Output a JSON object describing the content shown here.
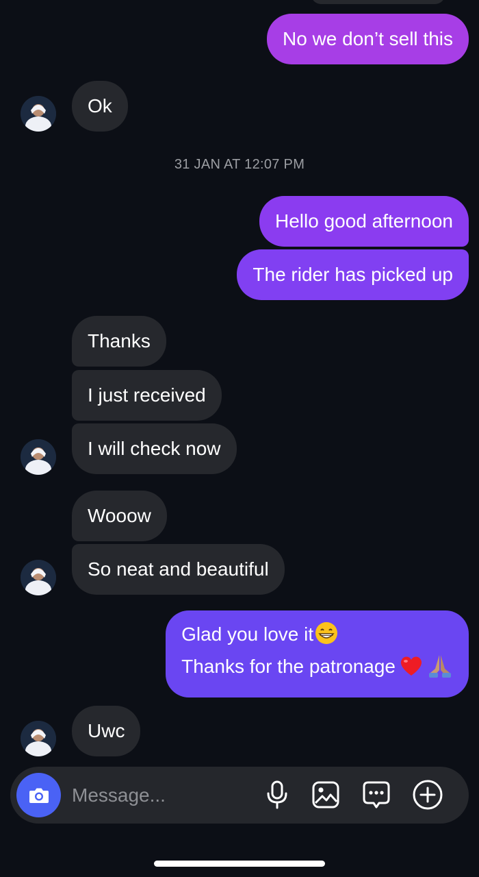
{
  "thread": {
    "date_separator": "31 JAN AT 12:07 PM",
    "messages": [
      {
        "from": "me",
        "text": "No we don’t sell this",
        "color": "#a73ee6"
      },
      {
        "from": "them",
        "text": "Ok"
      },
      {
        "from": "me",
        "text": "Hello good afternoon",
        "color": "#8b3cf0"
      },
      {
        "from": "me",
        "text": "The rider has picked up",
        "color": "#8140f2"
      },
      {
        "from": "them",
        "text": "Thanks"
      },
      {
        "from": "them",
        "text": "I just received"
      },
      {
        "from": "them",
        "text": "I will check now"
      },
      {
        "from": "them",
        "text": "Wooow"
      },
      {
        "from": "them",
        "text": "So neat and beautiful"
      },
      {
        "from": "me",
        "line1": "Glad you love it",
        "line1_emoji": "grinning-face-emoji",
        "line2": "Thanks for the patronage",
        "line2_emojis": [
          "red-heart-emoji",
          "folded-hands-emoji"
        ],
        "color": "#6a46f2"
      },
      {
        "from": "them",
        "text": "Uwc"
      }
    ]
  },
  "composer": {
    "placeholder": "Message...",
    "icons": [
      "camera-icon",
      "microphone-icon",
      "gallery-icon",
      "sticker-icon",
      "plus-icon"
    ],
    "camera_color": "#4a62f5"
  },
  "colors": {
    "background": "#0c0f16",
    "incoming_bubble": "#26282d",
    "composer_bg": "#25272c"
  }
}
